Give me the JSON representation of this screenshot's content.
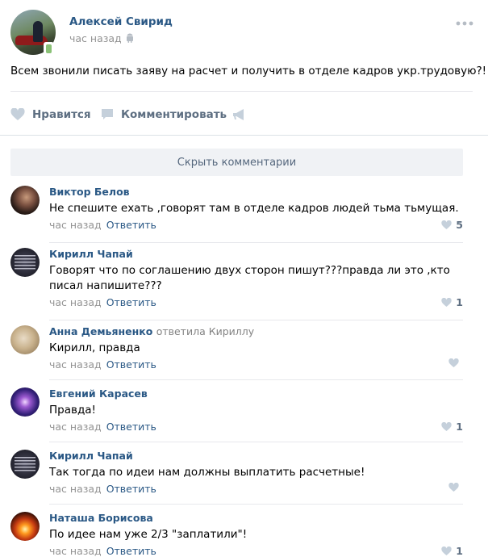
{
  "post": {
    "author": "Алексей Свирид",
    "time": "час назад",
    "text": "Всем звонили писать заяву на расчет и получить в отделе кадров укр.трудовую?!"
  },
  "actions": {
    "like_label": "Нравится",
    "comment_label": "Комментировать"
  },
  "comments_toggle": "Скрыть комментарии",
  "reply_label": "Ответить",
  "comments": [
    {
      "author": "Виктор Белов",
      "reply_to": "",
      "text": "Не спешите ехать ,говорят там в отделе кадров людей тьма тьмущая.",
      "time": "час назад",
      "likes": "5"
    },
    {
      "author": "Кирилл Чапай",
      "reply_to": "",
      "text": "Говорят что по соглашению двух сторон пишут???правда ли это ,кто писал напишите???",
      "time": "час назад",
      "likes": "1"
    },
    {
      "author": "Анна Демьяненко",
      "reply_to": "ответила Кириллу",
      "text": "Кирилл, правда",
      "time": "час назад",
      "likes": ""
    },
    {
      "author": "Евгений Карасев",
      "reply_to": "",
      "text": "Правда!",
      "time": "час назад",
      "likes": "1"
    },
    {
      "author": "Кирилл Чапай",
      "reply_to": "",
      "text": "Так тогда по идеи нам должны выплатить расчетные!",
      "time": "час назад",
      "likes": ""
    },
    {
      "author": "Наташа Борисова",
      "reply_to": "",
      "text": "По идее нам уже 2/3 \"заплатили\"!",
      "time": "час назад",
      "likes": "1"
    }
  ]
}
